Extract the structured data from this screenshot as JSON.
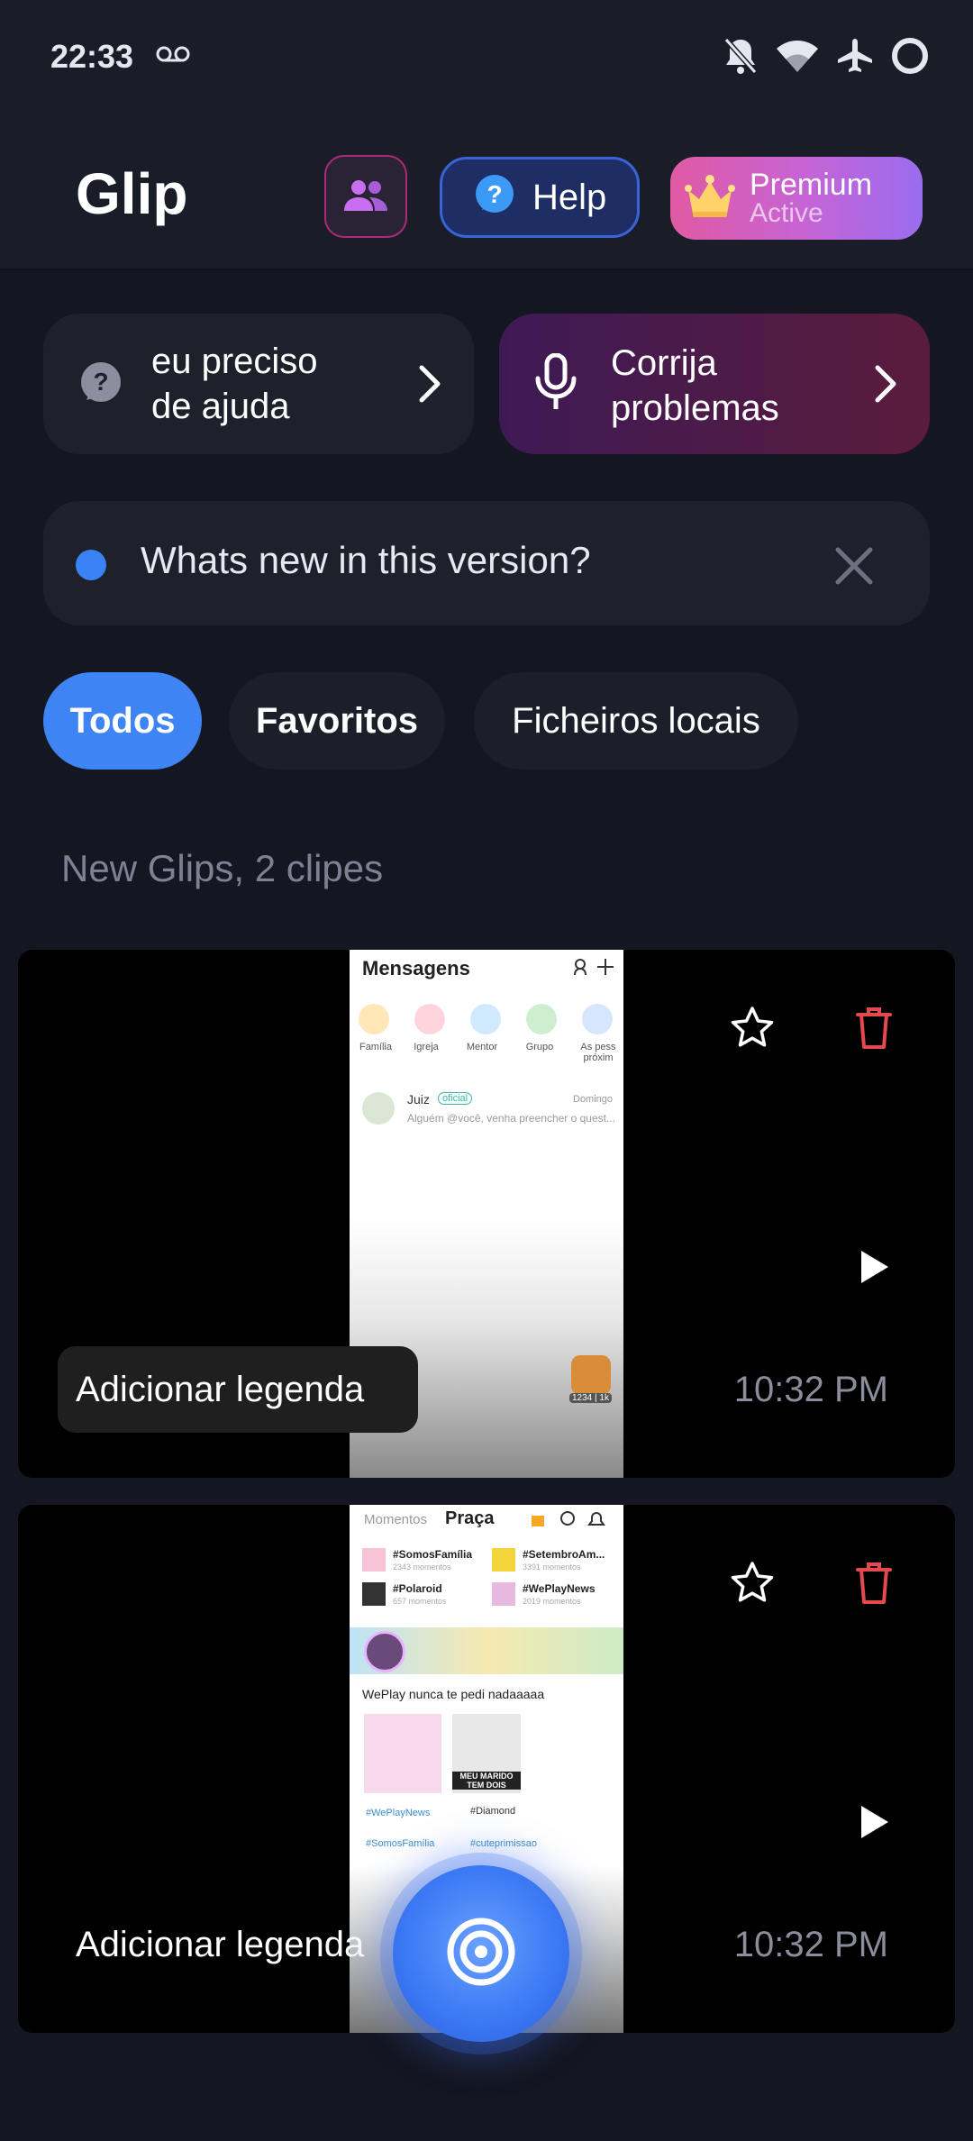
{
  "status_bar": {
    "time": "22:33"
  },
  "header": {
    "app_title": "Glip",
    "help_label": "Help",
    "premium_title": "Premium",
    "premium_status": "Active"
  },
  "quick_actions": {
    "help_line1": "eu preciso",
    "help_line2": "de ajuda",
    "fix_line1": "Corrija",
    "fix_line2": "problemas"
  },
  "notice": {
    "text": "Whats new in this version?"
  },
  "filters": {
    "all": "Todos",
    "favorites": "Favoritos",
    "local": "Ficheiros locais"
  },
  "section": {
    "title": "New Glips, 2 clipes"
  },
  "clips": [
    {
      "caption": "Adicionar legenda",
      "time": "10:32 PM",
      "thumb": {
        "heading": "Mensagens",
        "categories": [
          "Família",
          "Igreja",
          "Mentor",
          "Grupo",
          "As pess próxim"
        ],
        "chat_name": "Juiz",
        "chat_tag": "oficial",
        "chat_day": "Domingo",
        "chat_preview": "Alguém @você, venha preencher o quest...",
        "badge": "1234 | 1k"
      }
    },
    {
      "caption": "Adicionar legenda",
      "time": "10:32 PM",
      "thumb": {
        "tab1": "Momentos",
        "tab2": "Praça",
        "tags": [
          "#SomosFamília",
          "#SetembroAm...",
          "#Polaroid",
          "#WePlayNews"
        ],
        "tag_counts": [
          "2343 momentos",
          "3391 momentos",
          "657 momentos",
          "2019 momentos"
        ],
        "post_text": "WePlay nunca te pedi nadaaaaa",
        "sticker_text": "MEU MARIDO TEM DOIS",
        "chips": [
          "#WePlayNews",
          "#Diamond",
          "#SomosFamília",
          "#cuteprimissao"
        ]
      }
    }
  ]
}
